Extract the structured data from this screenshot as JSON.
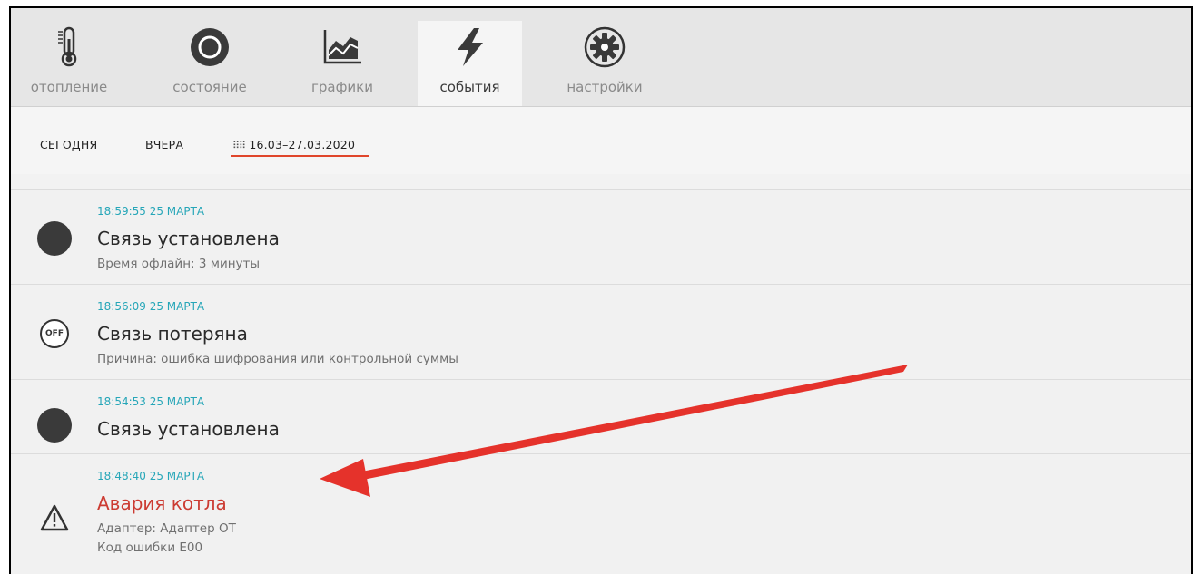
{
  "tabs": [
    {
      "label": "отопление",
      "icon": "thermometer-icon"
    },
    {
      "label": "состояние",
      "icon": "ring-icon"
    },
    {
      "label": "графики",
      "icon": "chart-icon"
    },
    {
      "label": "события",
      "icon": "lightning-icon",
      "active": true
    },
    {
      "label": "настройки",
      "icon": "gear-icon"
    }
  ],
  "filters": {
    "today": "СЕГОДНЯ",
    "yesterday": "ВЧЕРА",
    "date_range": "16.03–27.03.2020"
  },
  "events": [
    {
      "time": "18:59:55 25 МАРТА",
      "title": "Связь установлена",
      "detail1": "Время офлайн: 3 минуты",
      "icon": "filled-dot-icon"
    },
    {
      "time": "18:56:09 25 МАРТА",
      "title": "Связь потеряна",
      "detail1": "Причина: ошибка шифрования или контрольной суммы",
      "icon": "off-icon",
      "icon_text": "OFF"
    },
    {
      "time": "18:54:53 25 МАРТА",
      "title": "Связь установлена",
      "icon": "filled-dot-icon"
    },
    {
      "time": "18:48:40 25 МАРТА",
      "title": "Авария котла",
      "detail1": "Адаптер: Адаптер ОТ",
      "detail2": "Код ошибки E00",
      "icon": "warning-icon",
      "alert": true
    }
  ],
  "colors": {
    "accent_time": "#26a6b8",
    "alert_red": "#cc3b32",
    "underline": "#e0462b",
    "annotation_arrow": "#e5322b"
  }
}
